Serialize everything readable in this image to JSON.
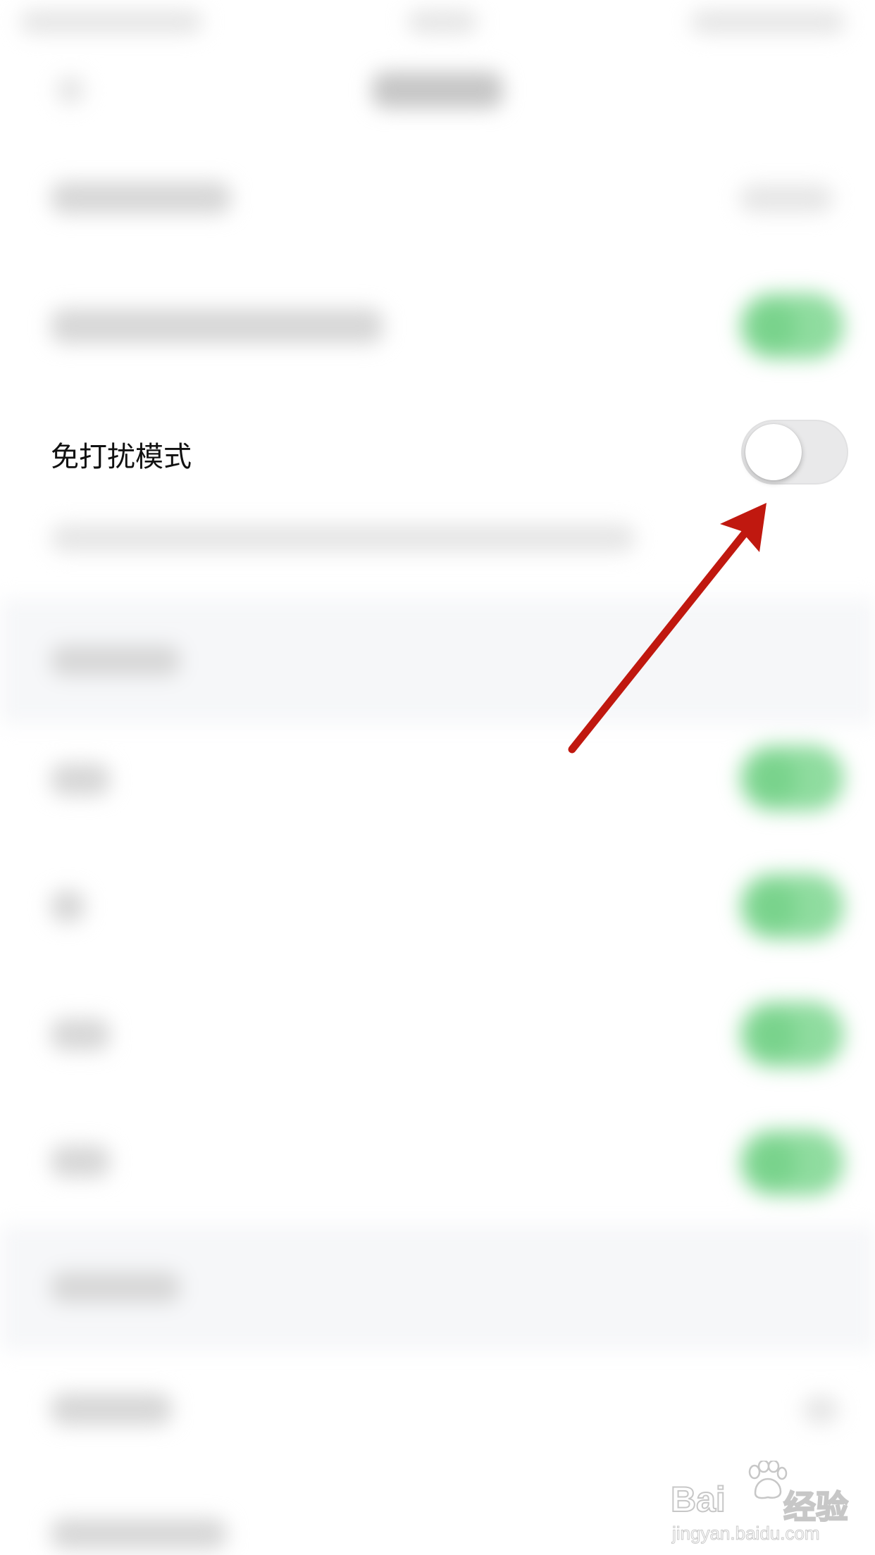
{
  "settings": {
    "focus_row": {
      "label": "免打扰模式",
      "toggle_state": "off"
    }
  },
  "colors": {
    "annotation_arrow": "#c0180f",
    "toggle_off_track": "#e9e9ea",
    "toggle_on_blurred": "#79d38c"
  },
  "watermark": {
    "brand": "Bai",
    "brand_suffix": "经验",
    "url": "jingyan.baidu.com",
    "paw_icon": "baidu-paw-icon"
  }
}
